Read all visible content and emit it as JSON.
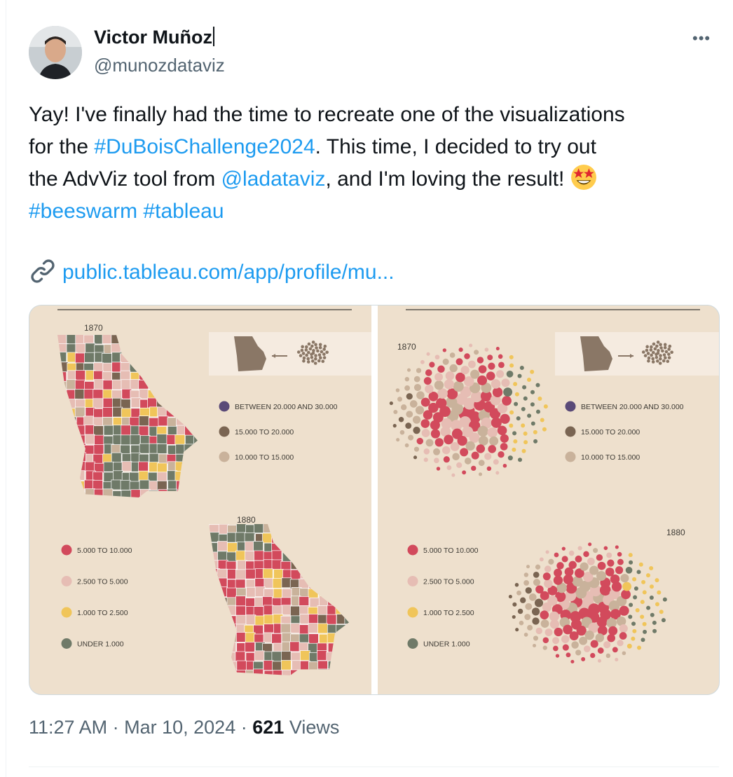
{
  "author": {
    "name": "Victor Muñoz",
    "handle": "@munozdataviz"
  },
  "more_label": "•••",
  "tweet": {
    "line1": "Yay! I've finally had the time to recreate one of the visualizations",
    "line2_pre": "for the ",
    "line2_tag": "#DuBoisChallenge2024",
    "line2_post": ". This time, I decided to try out",
    "line3_pre": "the AdvViz tool from ",
    "line3_mention": "@ladataviz",
    "line3_post": ", and I'm loving the result! ",
    "emoji": "star-struck-emoji",
    "tag_beeswarm": "#beeswarm",
    "tag_tableau": "#tableau"
  },
  "link": {
    "icon": "link-icon",
    "text": "public.tableau.com/app/profile/mu..."
  },
  "media": {
    "left_year_top": "1870",
    "left_year_bottom": "1880",
    "right_year_top": "1870",
    "right_year_bottom": "1880",
    "legend_upper": [
      {
        "label": "BETWEEN 20.000 AND 30.000",
        "color": "#5a4a78"
      },
      {
        "label": "15.000 TO 20.000",
        "color": "#7a6552"
      },
      {
        "label": "10.000 TO 15.000",
        "color": "#c9b29b"
      }
    ],
    "legend_lower": [
      {
        "label": "5.000 TO 10.000",
        "color": "#d24a5c"
      },
      {
        "label": "2.500 TO 5.000",
        "color": "#e6bdb4"
      },
      {
        "label": "1.000 TO 2.500",
        "color": "#f0c55a"
      },
      {
        "label": "UNDER 1.000",
        "color": "#6f7a68"
      }
    ]
  },
  "footer": {
    "time": "11:27 AM",
    "sep": "·",
    "date": "Mar 10, 2024",
    "views_count": "621",
    "views_label": "Views"
  }
}
